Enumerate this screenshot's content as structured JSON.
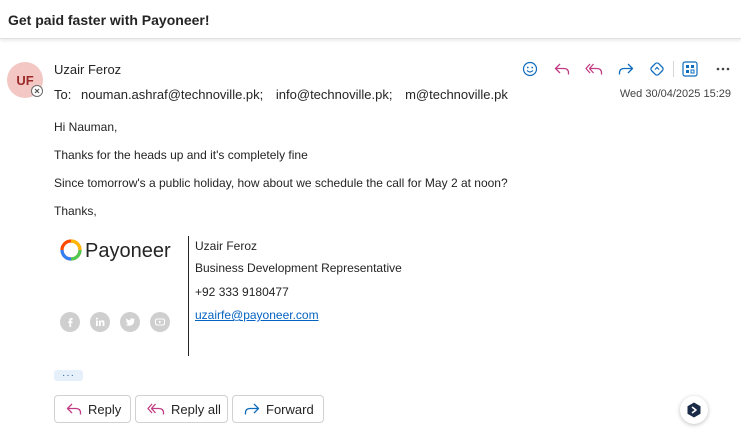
{
  "email": {
    "subject": "Get paid faster with Payoneer!",
    "avatar_initials": "UF",
    "sender": "Uzair Feroz",
    "to_label": "To:",
    "recipients": [
      "nouman.ashraf@technoville.pk;",
      "info@technoville.pk;",
      "m@technoville.pk"
    ],
    "date": "Wed 30/04/2025 15:29"
  },
  "toolbar": {
    "icons": [
      "emoji-icon",
      "reply-icon",
      "reply-all-icon",
      "forward-icon",
      "copilot-icon",
      "apps-icon",
      "more-icon"
    ]
  },
  "body": {
    "lines": [
      "Hi Nauman,",
      "Thanks for the heads up and it's completely fine",
      "Since tomorrow's a public holiday, how about we schedule the call for May 2 at noon?",
      "Thanks,"
    ]
  },
  "signature": {
    "logo_text": "Payoneer",
    "name": "Uzair Feroz",
    "title": "Business Development Representative",
    "phone": "+92 333 9180477",
    "email": "uzairfe@payoneer.com",
    "social_icons": [
      "facebook-icon",
      "linkedin-icon",
      "twitter-icon",
      "youtube-icon"
    ]
  },
  "footer": {
    "more_label": "···",
    "reply_label": "Reply",
    "reply_all_label": "Reply all",
    "forward_label": "Forward"
  },
  "colors": {
    "accent": "#0f6cbd",
    "reply_icon": "#c13b83",
    "avatar_bg": "#f3c7c3",
    "link": "#0563c1"
  }
}
